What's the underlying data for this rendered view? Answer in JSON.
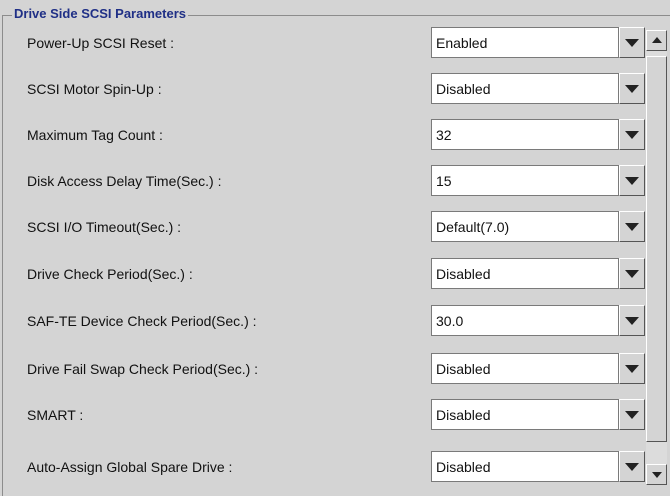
{
  "group": {
    "title": "Drive Side SCSI Parameters"
  },
  "params": [
    {
      "label": "Power-Up SCSI Reset :",
      "value": "Enabled"
    },
    {
      "label": "SCSI Motor Spin-Up :",
      "value": "Disabled"
    },
    {
      "label": "Maximum Tag Count :",
      "value": "32"
    },
    {
      "label": "Disk Access Delay  Time(Sec.) :",
      "value": "15"
    },
    {
      "label": "SCSI I/O Timeout(Sec.) :",
      "value": "Default(7.0)"
    },
    {
      "label": "Drive Check Period(Sec.) :",
      "value": "Disabled"
    },
    {
      "label": "SAF-TE Device Check Period(Sec.) :",
      "value": "30.0"
    },
    {
      "label": "Drive Fail Swap Check Period(Sec.) :",
      "value": "Disabled"
    },
    {
      "label": "SMART :",
      "value": "Disabled"
    },
    {
      "label": "Auto-Assign Global Spare Drive :",
      "value": "Disabled"
    }
  ],
  "icons": {
    "dropdown": "chevron-down-icon",
    "scroll_up": "arrow-up-icon",
    "scroll_down": "arrow-down-icon"
  },
  "colors": {
    "background": "#d4d4d4",
    "group_title": "#1f2f86",
    "field_background": "#ffffff"
  }
}
